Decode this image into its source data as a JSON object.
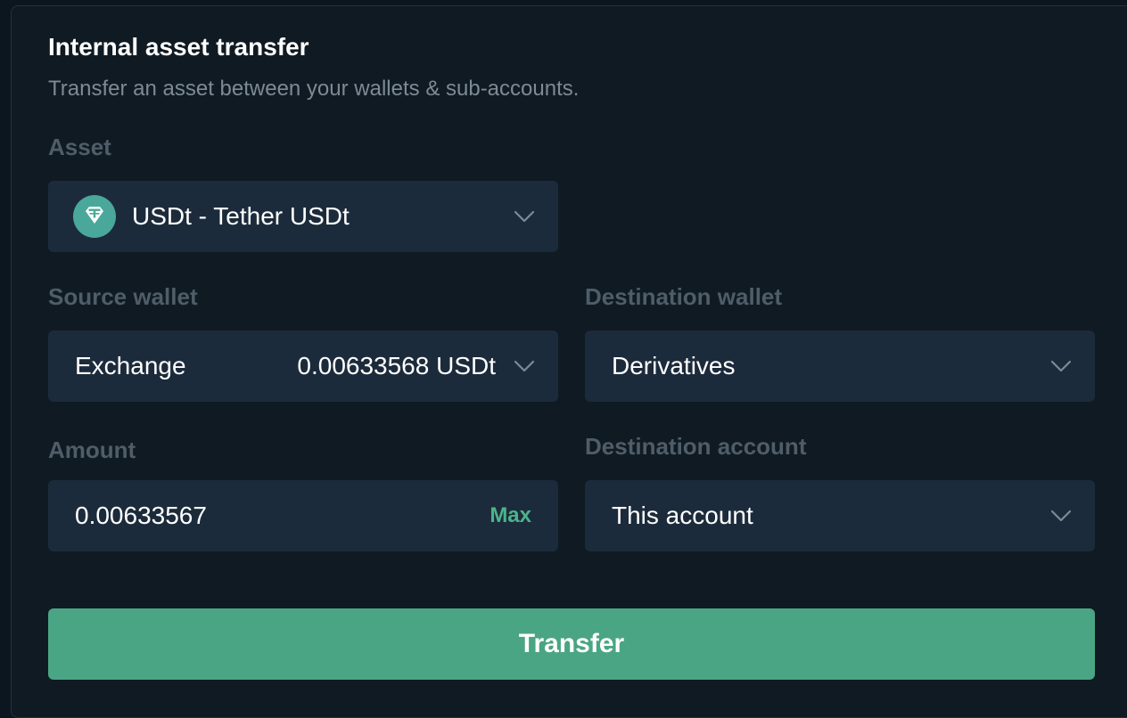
{
  "form": {
    "title": "Internal asset transfer",
    "subtitle": "Transfer an asset between your wallets & sub-accounts.",
    "asset": {
      "label": "Asset",
      "selected": "USDt - Tether USDt",
      "icon": "tether-icon",
      "icon_color": "#4aa89a"
    },
    "source_wallet": {
      "label": "Source wallet",
      "selected": "Exchange",
      "balance": "0.00633568 USDt"
    },
    "destination_wallet": {
      "label": "Destination wallet",
      "selected": "Derivatives"
    },
    "amount": {
      "label": "Amount",
      "value": "0.00633567",
      "max_label": "Max"
    },
    "destination_account": {
      "label": "Destination account",
      "selected": "This account"
    },
    "submit_label": "Transfer"
  },
  "colors": {
    "background": "#101a22",
    "field": "#1c2b3b",
    "accent": "#4aa584",
    "max_text": "#4cb38a",
    "label": "#4f5d68"
  }
}
